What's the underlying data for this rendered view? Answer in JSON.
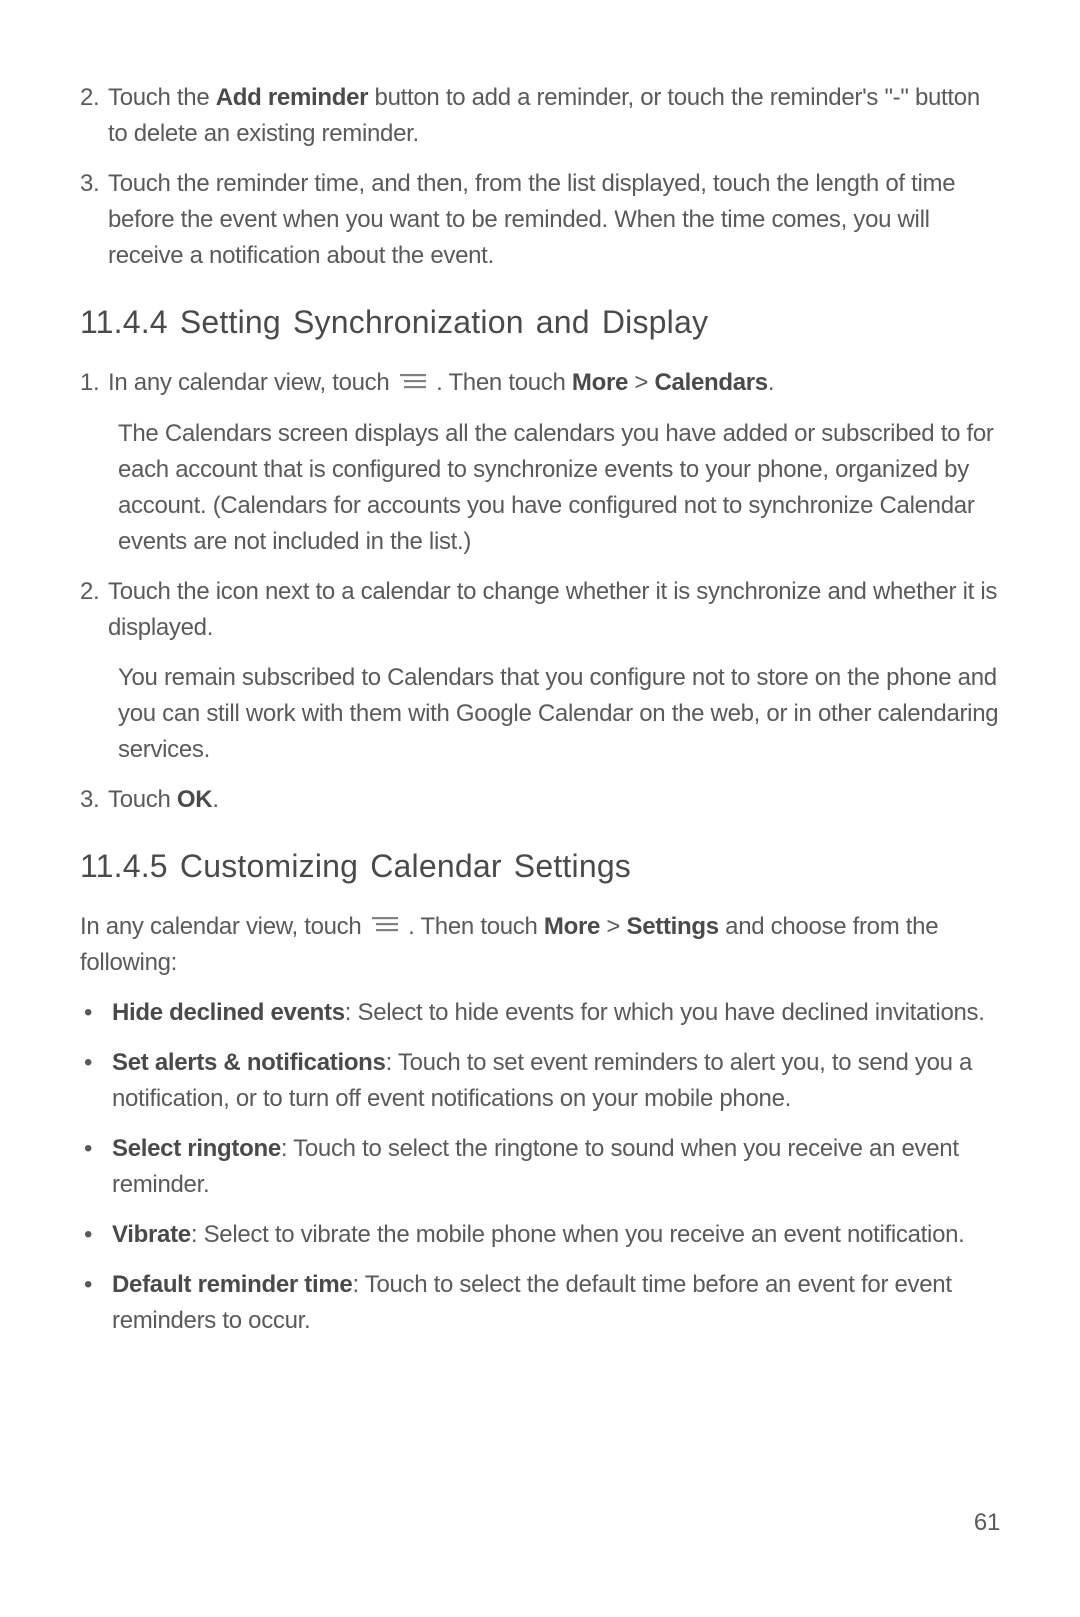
{
  "steps_top": [
    {
      "num": "2.",
      "pre": "Touch the ",
      "bold": "Add reminder",
      "post": " button to add a reminder, or touch the reminder's \"-\" button to delete an existing reminder."
    },
    {
      "num": "3.",
      "text": "Touch the reminder time, and then, from the list displayed, touch the length of time before the event when you want to be reminded. When the time comes, you will receive a notification about the event."
    }
  ],
  "section1": {
    "heading": "11.4.4  Setting Synchronization and Display",
    "steps": [
      {
        "num": "1.",
        "pre": "In any calendar view, touch ",
        "mid": " . Then touch ",
        "bold1": "More",
        "gt": " > ",
        "bold2": "Calendars",
        "post": ".",
        "sub": "The Calendars screen displays all the calendars you have added or subscribed to for each account that is configured to synchronize events to your phone, organized by account. (Calendars for accounts you have configured not to synchronize Calendar events are not included in the list.)"
      },
      {
        "num": "2.",
        "text": "Touch the icon next to a calendar to change whether it is synchronize and whether it is displayed.",
        "sub": "You remain subscribed to Calendars that you configure not to store on the phone and you can still work with them with Google Calendar on the web, or in other calendaring services."
      },
      {
        "num": "3.",
        "pre": "Touch ",
        "bold": "OK",
        "post": "."
      }
    ]
  },
  "section2": {
    "heading": "11.4.5  Customizing Calendar Settings",
    "intro_pre": "In any calendar view, touch ",
    "intro_mid": " . Then touch ",
    "intro_bold1": "More",
    "intro_gt": " > ",
    "intro_bold2": "Settings",
    "intro_post": " and choose from the following:",
    "bullets": [
      {
        "bold": "Hide declined events",
        "text": ": Select to hide events for which you have declined invitations."
      },
      {
        "bold": "Set alerts & notifications",
        "text": ": Touch to set event reminders to alert you, to send you a notification, or to turn off event notifications on your mobile phone."
      },
      {
        "bold": "Select ringtone",
        "text": ": Touch to select the ringtone to sound when you receive an event reminder."
      },
      {
        "bold": "Vibrate",
        "text": ": Select to vibrate the mobile phone when you receive an event notification."
      },
      {
        "bold": "Default reminder time",
        "text": ": Touch to select the default time before an event for event reminders to occur."
      }
    ]
  },
  "page_number": "61"
}
